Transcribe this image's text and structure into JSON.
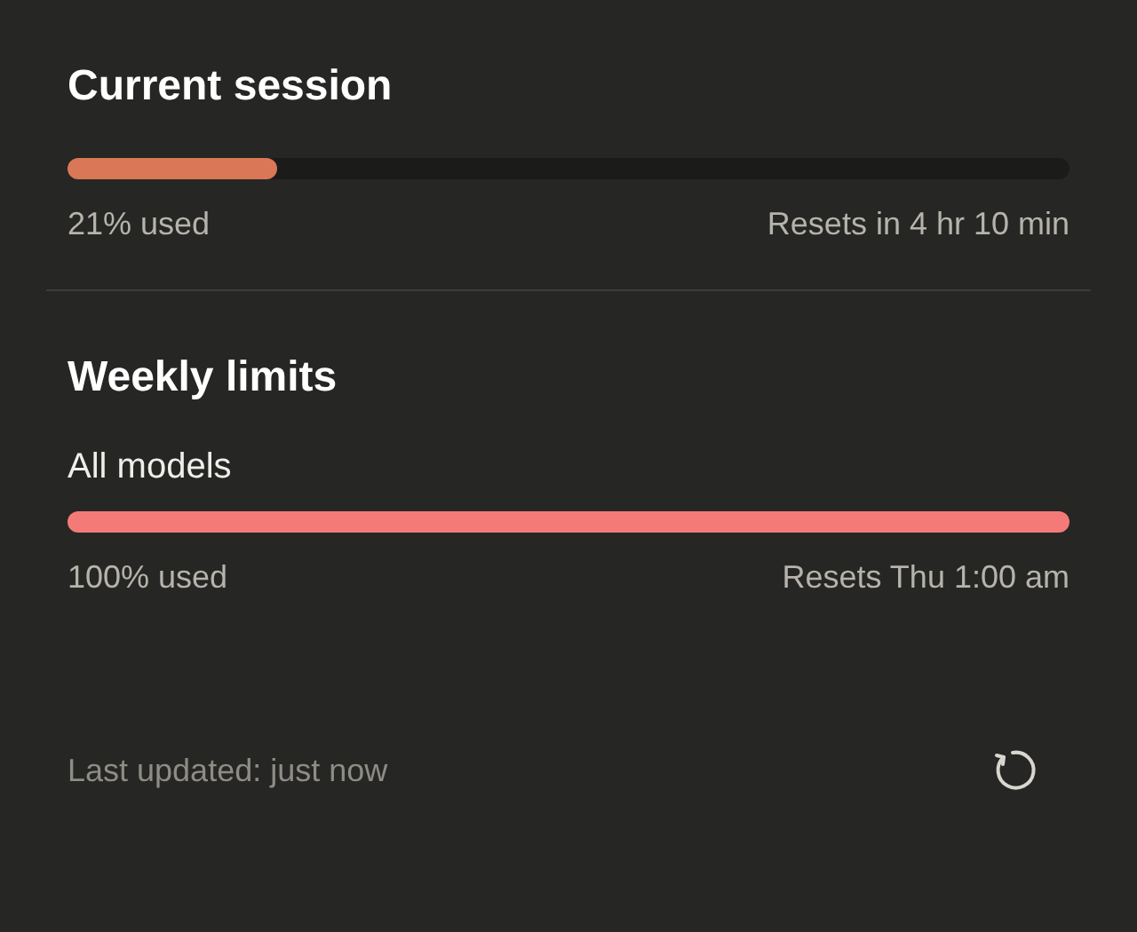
{
  "current_session": {
    "title": "Current session",
    "level": 0.21,
    "used": "21% used",
    "resets": "Resets in 4 hr 10 min"
  },
  "weekly_limits": {
    "title": "Weekly limits",
    "models": [
      {
        "label": "All models",
        "level": 1,
        "used": "100% used",
        "resets": "Resets Thu 1:00 am"
      }
    ]
  },
  "footer": {
    "last_updated": "Last updated: just now"
  }
}
